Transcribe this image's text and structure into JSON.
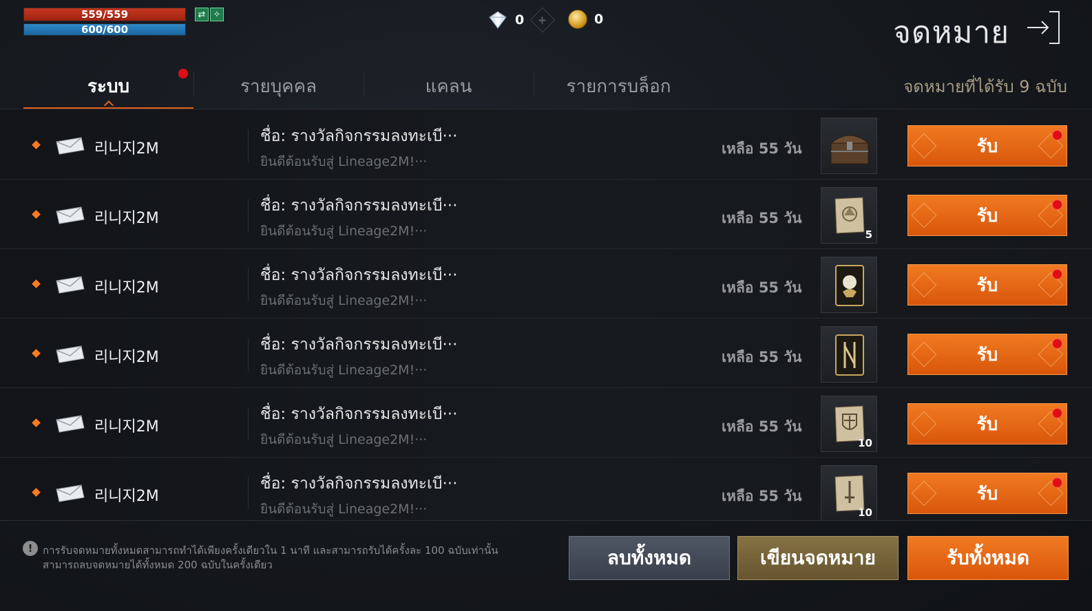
{
  "status": {
    "hp": "559/559",
    "mp": "600/600"
  },
  "currency": {
    "diamond": "0",
    "gold": "0"
  },
  "header": {
    "title": "จดหมาย"
  },
  "tabs": [
    {
      "label": "ระบบ",
      "active": true,
      "has_dot": true
    },
    {
      "label": "รายบุคคล",
      "active": false
    },
    {
      "label": "แคลน",
      "active": false
    },
    {
      "label": "รายการบล็อก",
      "active": false
    }
  ],
  "mail_count": "จดหมายที่ได้รับ 9 ฉบับ",
  "mails": [
    {
      "sender": "리니지2M",
      "subject": "ชื่อ: รางวัลกิจกรรมลงทะเบี···",
      "preview": "ยินดีต้อนรับสู่ Lineage2M!···",
      "expire": "เหลือ 55 วัน",
      "item": "treasure-chest-icon",
      "qty": "",
      "button": "รับ"
    },
    {
      "sender": "리니지2M",
      "subject": "ชื่อ: รางวัลกิจกรรมลงทะเบี···",
      "preview": "ยินดีต้อนรับสู่ Lineage2M!···",
      "expire": "เหลือ 55 วัน",
      "item": "scroll-icon",
      "qty": "5",
      "button": "รับ"
    },
    {
      "sender": "리니지2M",
      "subject": "ชื่อ: รางวัลกิจกรรมลงทะเบี···",
      "preview": "ยินดีต้อนรับสู่ Lineage2M!···",
      "expire": "เหลือ 55 วัน",
      "item": "card-icon",
      "qty": "",
      "button": "รับ"
    },
    {
      "sender": "리니지2M",
      "subject": "ชื่อ: รางวัลกิจกรรมลงทะเบี···",
      "preview": "ยินดีต้อนรับสู่ Lineage2M!···",
      "expire": "เหลือ 55 วัน",
      "item": "card-icon",
      "qty": "",
      "button": "รับ"
    },
    {
      "sender": "리니지2M",
      "subject": "ชื่อ: รางวัลกิจกรรมลงทะเบี···",
      "preview": "ยินดีต้อนรับสู่ Lineage2M!···",
      "expire": "เหลือ 55 วัน",
      "item": "shield-scroll-icon",
      "qty": "10",
      "button": "รับ"
    },
    {
      "sender": "리니지2M",
      "subject": "ชื่อ: รางวัลกิจกรรมลงทะเบี···",
      "preview": "ยินดีต้อนรับสู่ Lineage2M!···",
      "expire": "เหลือ 55 วัน",
      "item": "sword-scroll-icon",
      "qty": "10",
      "button": "รับ"
    }
  ],
  "footer": {
    "notice_line1": "การรับจดหมายทั้งหมดสามารถทำได้เพียงครั้งเดียวใน 1 นาที และสามารถรับได้ครั้งละ 100 ฉบับเท่านั้น",
    "notice_line2": "สามารถลบจดหมายได้ทั้งหมด 200 ฉบับในครั้งเดียว",
    "delete_all": "ลบทั้งหมด",
    "write_mail": "เขียนจดหมาย",
    "receive_all": "รับทั้งหมด"
  },
  "colors": {
    "accent": "#e8621d",
    "notify_dot": "#e00d16",
    "hp": "#c3361e",
    "mp": "#2e88c7"
  }
}
